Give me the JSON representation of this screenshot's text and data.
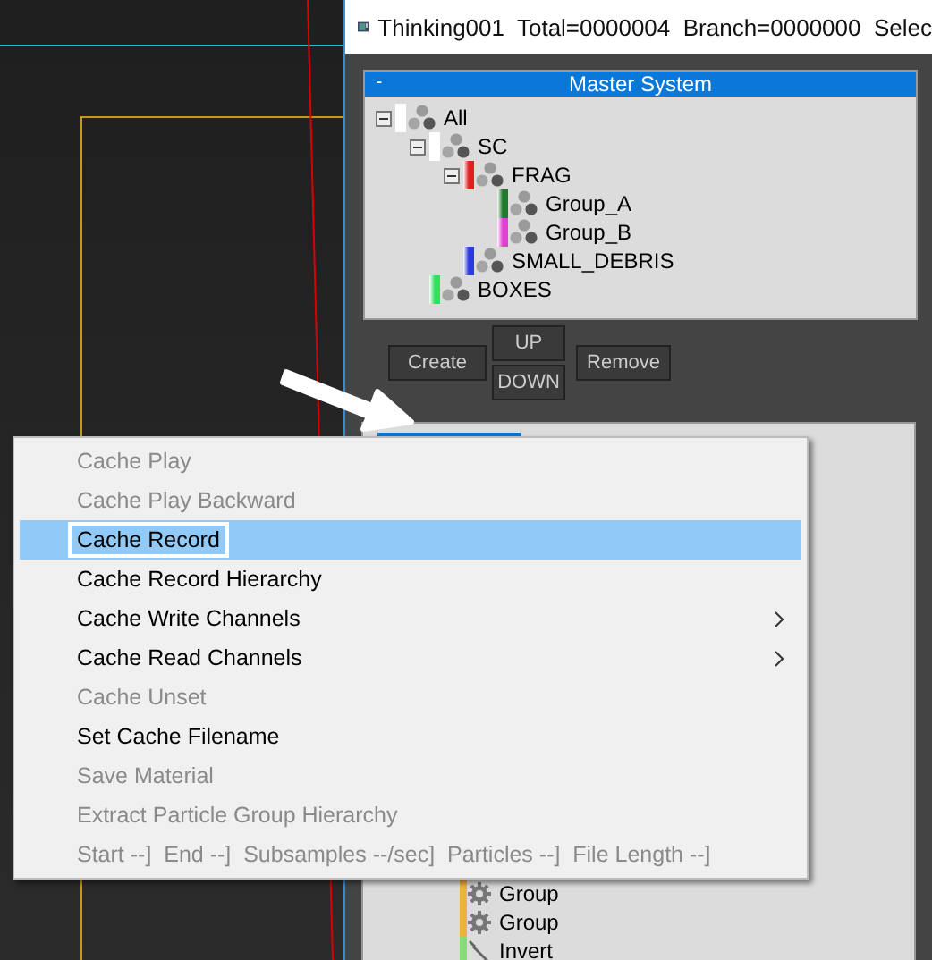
{
  "window": {
    "title": "Thinking001  Total=0000004  Branch=0000000  Selec"
  },
  "master_system": {
    "title": "Master System",
    "collapse": "-",
    "tree": [
      {
        "label": "All",
        "color": "#ffffff",
        "expanded": true,
        "children": [
          {
            "label": "SC",
            "color": "#ffffff",
            "expanded": true,
            "children": [
              {
                "label": "FRAG",
                "color": "#e02020",
                "expanded": true,
                "children": [
                  {
                    "label": "Group_A",
                    "color": "#1f7a2e"
                  },
                  {
                    "label": "Group_B",
                    "color": "#e040d0"
                  }
                ]
              },
              {
                "label": "SMALL_DEBRIS",
                "color": "#2a3ae0"
              }
            ]
          },
          {
            "label": "BOXES",
            "color": "#30e060"
          }
        ]
      }
    ]
  },
  "buttons": {
    "create": "Create",
    "up": "UP",
    "down": "DOWN",
    "remove": "Remove"
  },
  "master_dynamic": {
    "items": [
      {
        "label": "Group",
        "kind": "gear",
        "color": "#f0b040"
      },
      {
        "label": "Group",
        "kind": "gear",
        "color": "#f0b040"
      },
      {
        "label": "Invert",
        "kind": "wrench",
        "color": "#80e070"
      }
    ]
  },
  "context_menu": [
    {
      "label": "Cache Play",
      "disabled": true,
      "selected": false,
      "submenu": false
    },
    {
      "label": "Cache Play Backward",
      "disabled": true,
      "selected": false,
      "submenu": false
    },
    {
      "label": "Cache Record",
      "disabled": false,
      "selected": true,
      "submenu": false
    },
    {
      "label": "Cache Record Hierarchy",
      "disabled": false,
      "selected": false,
      "submenu": false
    },
    {
      "label": "Cache Write Channels",
      "disabled": false,
      "selected": false,
      "submenu": true
    },
    {
      "label": "Cache Read Channels",
      "disabled": false,
      "selected": false,
      "submenu": true
    },
    {
      "label": "Cache Unset",
      "disabled": true,
      "selected": false,
      "submenu": false
    },
    {
      "label": "Set Cache Filename",
      "disabled": false,
      "selected": false,
      "submenu": false
    },
    {
      "label": "Save Material",
      "disabled": true,
      "selected": false,
      "submenu": false
    },
    {
      "label": "Extract Particle Group Hierarchy",
      "disabled": true,
      "selected": false,
      "submenu": false
    },
    {
      "label": "Start --]  End --]  Subsamples --/sec]  Particles --]  File Length --]",
      "disabled": true,
      "selected": false,
      "submenu": false
    }
  ]
}
